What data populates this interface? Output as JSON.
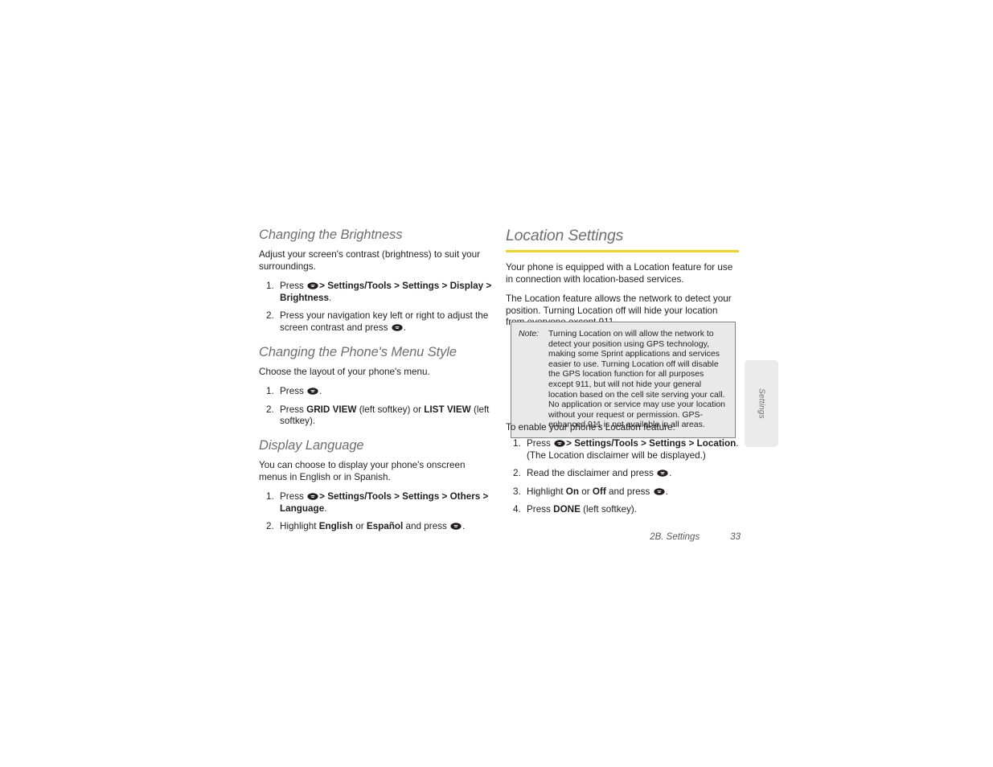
{
  "document": {
    "footer": {
      "chapter": "2B. Settings",
      "page_number": "33"
    },
    "side_tab": {
      "label": "Settings"
    }
  },
  "left_column": {
    "sections": [
      {
        "heading": "Changing the Brightness",
        "intro": "Adjust your screen's contrast (brightness) to suit your surroundings.",
        "steps": [
          {
            "pre": "Press ",
            "icon": "menu-key-icon",
            "post_bold": "> Settings/Tools > Settings > Display > Brightness",
            "tail": "."
          },
          {
            "pre": "Press your navigation key left or right to adjust the screen contrast and press ",
            "icon": "menu-key-icon",
            "tail": "."
          }
        ]
      },
      {
        "heading": "Changing the Phone's Menu Style",
        "intro": "Choose the layout of your phone's menu.",
        "steps": [
          {
            "pre": "Press ",
            "icon": "menu-key-icon",
            "tail": "."
          },
          {
            "pre": "Press ",
            "bold1": "GRID VIEW",
            "mid1": " (left softkey) or ",
            "bold2": "LIST VIEW",
            "mid2": " (left softkey)."
          }
        ]
      },
      {
        "heading": "Display Language",
        "intro": "You can choose to display your phone's onscreen menus in English or in Spanish.",
        "steps": [
          {
            "pre": "Press ",
            "icon": "menu-key-icon",
            "post_bold": "> Settings/Tools > Settings > Others > Language",
            "tail": "."
          },
          {
            "pre": "Highlight ",
            "bold1": "English",
            "mid1": " or ",
            "bold2": "Español",
            "mid2": " and press ",
            "icon": "menu-key-icon",
            "tail": "."
          }
        ]
      }
    ]
  },
  "right_column": {
    "heading": "Location Settings",
    "rule_color": "#f2d51a",
    "paragraphs": [
      "Your phone is equipped with a Location feature for use in connection with location-based services.",
      "The Location feature allows the network to detect your position. Turning Location off will hide your location from everyone except 911."
    ],
    "note": {
      "label": "Note:",
      "text": "Turning Location on will allow the network to detect your position using GPS technology, making some Sprint applications and services easier to use. Turning Location off will disable the GPS location function for all purposes except 911, but will not hide your general location based on the cell site serving your call. No application or service may use your location without your request or permission. GPS-enhanced 911 is not available in all areas.",
      "background": "#e9e9e9",
      "border": "#808285"
    },
    "lead_in": "To enable your phone's Location feature:",
    "steps": [
      {
        "pre": "Press ",
        "icon": "menu-key-icon",
        "post_bold": "> Settings/Tools > Settings > Location",
        "tail": ". (The Location disclaimer will be displayed.)"
      },
      {
        "pre": "Read the disclaimer and press ",
        "icon": "menu-key-icon",
        "tail": "."
      },
      {
        "pre": "Highlight ",
        "bold1": "On",
        "mid1": " or ",
        "bold2": "Off",
        "mid2": " and press ",
        "icon": "menu-key-icon",
        "tail": "."
      },
      {
        "pre": "Press ",
        "bold1": "DONE",
        "mid1": " (left softkey)."
      }
    ]
  }
}
